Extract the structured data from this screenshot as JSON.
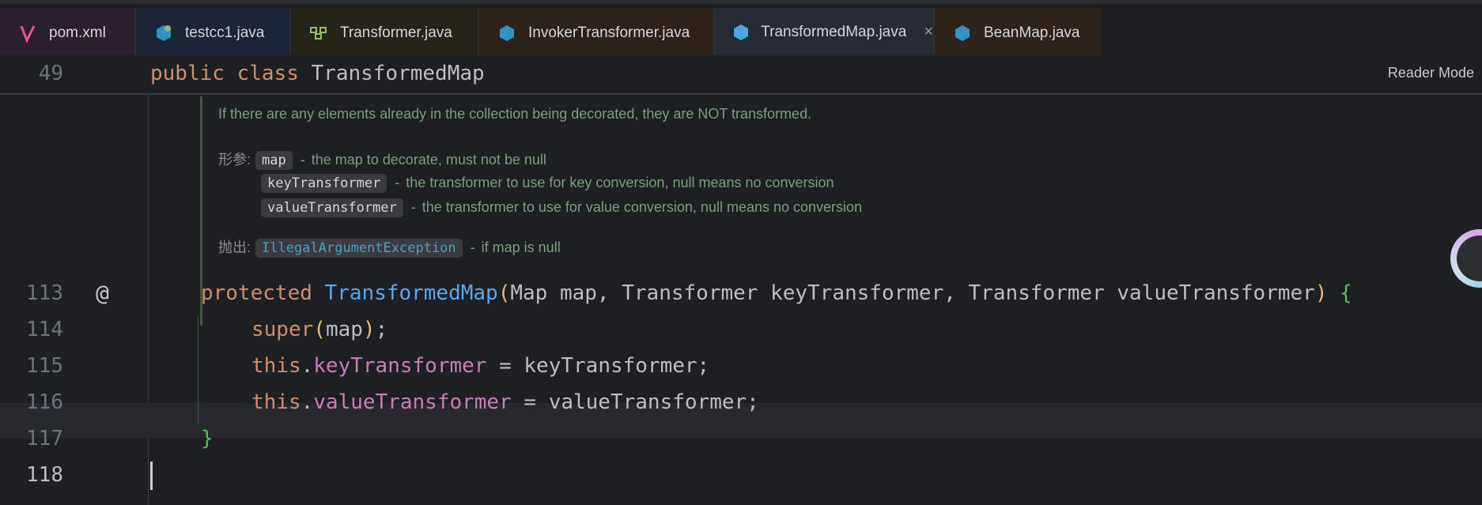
{
  "tabs": [
    {
      "name": "pom.xml",
      "icon": "maven-icon"
    },
    {
      "name": "testcc1.java",
      "icon": "java-class-icon"
    },
    {
      "name": "Transformer.java",
      "icon": "interface-icon"
    },
    {
      "name": "InvokerTransformer.java",
      "icon": "java-class-icon"
    },
    {
      "name": "TransformedMap.java",
      "icon": "java-class-icon",
      "active": true,
      "close": "×"
    },
    {
      "name": "BeanMap.java",
      "icon": "java-class-icon"
    }
  ],
  "reader_mode": "Reader Mode",
  "sticky": {
    "line": "49",
    "kw1": "public",
    "kw2": "class",
    "name": "TransformedMap"
  },
  "doc": {
    "intro": "If there are any elements already in the collection being decorated, they are NOT transformed.",
    "params_label": "形参:",
    "params": [
      {
        "name": "map",
        "desc": "the map to decorate, must not be null"
      },
      {
        "name": "keyTransformer",
        "desc": "the transformer to use for key conversion, null means no conversion"
      },
      {
        "name": "valueTransformer",
        "desc": "the transformer to use for value conversion, null means no conversion"
      }
    ],
    "throws_label": "抛出:",
    "throws": {
      "name": "IllegalArgumentException",
      "desc": "if map is null"
    },
    "dash": "-"
  },
  "lines": {
    "l113": "113",
    "l114": "114",
    "l115": "115",
    "l116": "116",
    "l117": "117",
    "l118": "118"
  },
  "code": {
    "annotation_marker": "@",
    "ctor_kw": "protected",
    "ctor_name": "TransformedMap",
    "ctor_params": "Map map, Transformer keyTransformer, Transformer valueTransformer",
    "super_kw": "super",
    "super_arg": "map",
    "this_kw": "this",
    "key_field": "keyTransformer",
    "key_value": " = keyTransformer;",
    "value_field": "valueTransformer",
    "value_value": " = valueTransformer;",
    "close_brace": "}"
  },
  "colors": {
    "accent": "#8e6ae4",
    "keyword": "#cf8e6d",
    "function": "#56a8f5",
    "field": "#c77dbb"
  }
}
